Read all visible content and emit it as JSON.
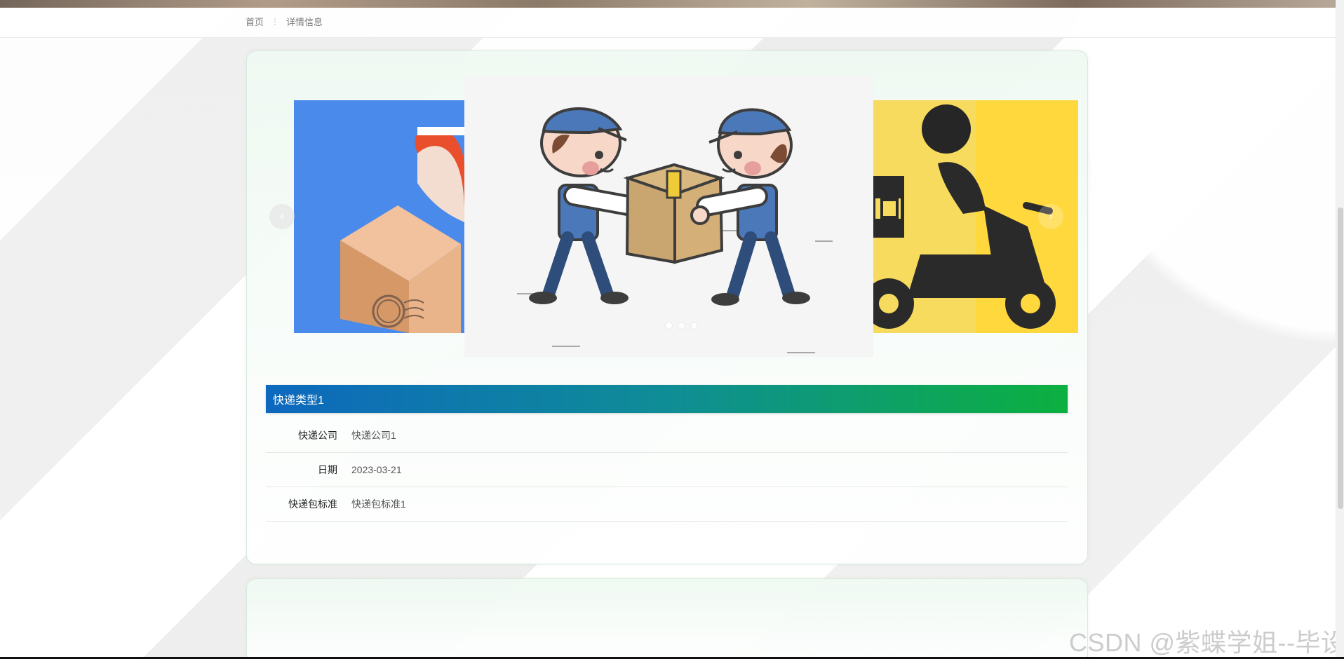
{
  "breadcrumb": {
    "home": "首页",
    "current": "详情信息"
  },
  "carousel": {
    "active_index": 1,
    "slides": [
      {
        "name": "delivery-box-slide"
      },
      {
        "name": "couriers-carrying-box-slide"
      },
      {
        "name": "scooter-delivery-slide"
      }
    ],
    "prev_icon": "chevron-left-icon",
    "next_icon": "chevron-right-icon"
  },
  "detail": {
    "title": "快递类型1",
    "rows": [
      {
        "label": "快递公司",
        "value": "快递公司1"
      },
      {
        "label": "日期",
        "value": "2023-03-21"
      },
      {
        "label": "快递包标准",
        "value": "快递包标准1"
      }
    ]
  },
  "watermark": "CSDN @紫蝶学姐--毕设",
  "colors": {
    "title_gradient_start": "#0d68be",
    "title_gradient_end": "#0cb03f"
  }
}
